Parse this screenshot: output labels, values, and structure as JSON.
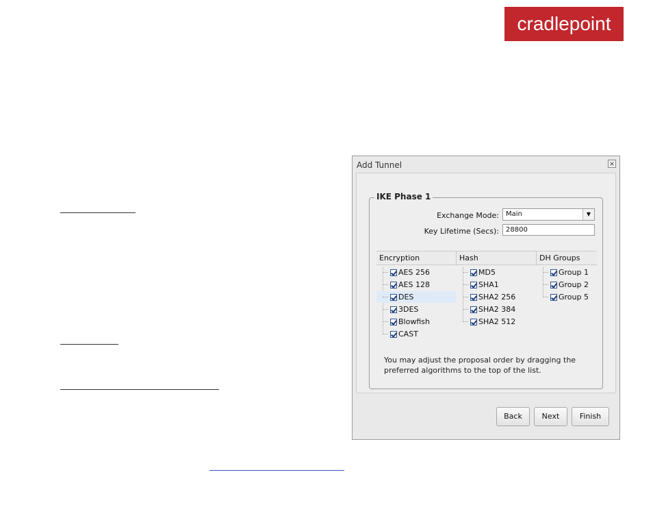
{
  "brand": {
    "logo_text": "cradlepoint",
    "color": "#c1272d"
  },
  "dialog": {
    "title": "Add Tunnel",
    "close_icon": "close-icon",
    "section_title": "IKE Phase 1",
    "exchange_mode": {
      "label": "Exchange Mode:",
      "value": "Main"
    },
    "key_lifetime": {
      "label": "Key Lifetime (Secs):",
      "value": "28800"
    },
    "columns": {
      "encryption": {
        "header": "Encryption",
        "items": [
          "AES 256",
          "AES 128",
          "DES",
          "3DES",
          "Blowfish",
          "CAST"
        ]
      },
      "hash": {
        "header": "Hash",
        "items": [
          "MD5",
          "SHA1",
          "SHA2 256",
          "SHA2 384",
          "SHA2 512"
        ]
      },
      "dh_groups": {
        "header": "DH Groups",
        "items": [
          "Group 1",
          "Group 2",
          "Group 5"
        ]
      }
    },
    "selected_item": "DES",
    "hint_text": "You may adjust the proposal order by dragging the preferred algorithms to the top of the list.",
    "buttons": {
      "back": "Back",
      "next": "Next",
      "finish": "Finish"
    }
  }
}
